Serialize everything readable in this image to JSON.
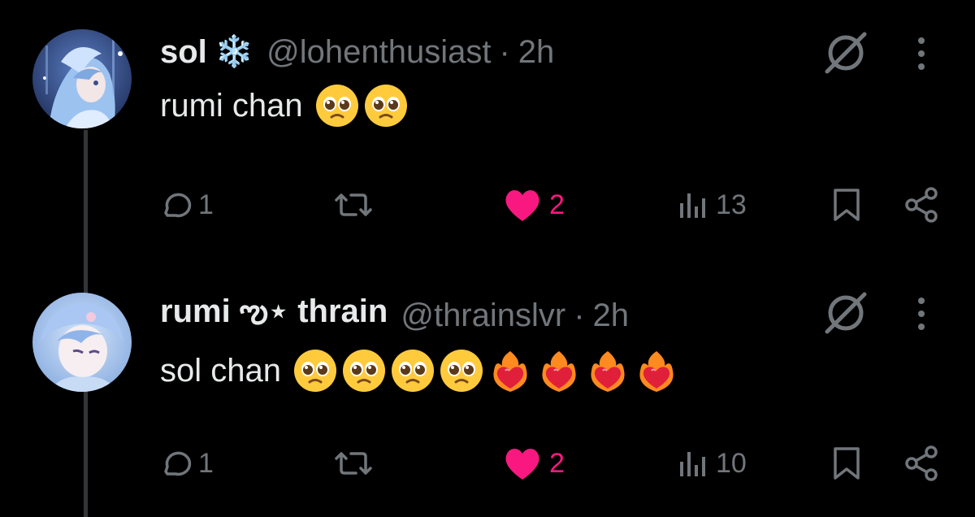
{
  "tweets": [
    {
      "author_name": "sol",
      "name_emoji": "❄️",
      "handle": "@lohenthusiast",
      "separator": "·",
      "time": "2h",
      "text": "rumi chan",
      "emojis": [
        "pleading-face",
        "pleading-face"
      ],
      "avatar_icon": "anime-avatar-icon",
      "actions": {
        "replies": "1",
        "retweets": "",
        "likes": "2",
        "liked": true,
        "views": "13"
      }
    },
    {
      "author_name": "rumi ఌ⋆ thrain",
      "name_emoji": "",
      "handle": "@thrainslvr",
      "separator": "·",
      "time": "2h",
      "text": "sol chan",
      "emojis": [
        "pleading-face",
        "pleading-face",
        "pleading-face",
        "pleading-face",
        "heart-on-fire",
        "heart-on-fire",
        "heart-on-fire",
        "heart-on-fire"
      ],
      "avatar_icon": "anime-avatar-icon",
      "actions": {
        "replies": "1",
        "retweets": "",
        "likes": "2",
        "liked": true,
        "views": "10"
      }
    }
  ],
  "colors": {
    "background": "#000000",
    "primary_text": "#e7e9ea",
    "secondary_text": "#71767b",
    "like_pink": "#f91880",
    "thread_line": "#333639"
  }
}
